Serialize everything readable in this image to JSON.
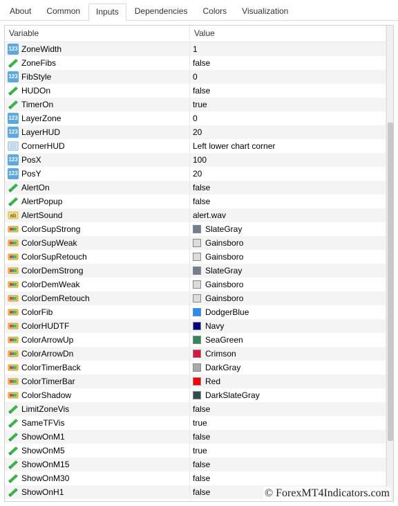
{
  "tabs": {
    "items": [
      "About",
      "Common",
      "Inputs",
      "Dependencies",
      "Colors",
      "Visualization"
    ],
    "active": 2
  },
  "headers": {
    "variable": "Variable",
    "value": "Value"
  },
  "rows": [
    {
      "icon": "int",
      "name": "ZoneWidth",
      "value": "1"
    },
    {
      "icon": "bool",
      "name": "ZoneFibs",
      "value": "false"
    },
    {
      "icon": "int",
      "name": "FibStyle",
      "value": "0"
    },
    {
      "icon": "bool",
      "name": "HUDOn",
      "value": "false"
    },
    {
      "icon": "bool",
      "name": "TimerOn",
      "value": "true"
    },
    {
      "icon": "int",
      "name": "LayerZone",
      "value": "0"
    },
    {
      "icon": "int",
      "name": "LayerHUD",
      "value": "20"
    },
    {
      "icon": "enum",
      "name": "CornerHUD",
      "value": "Left lower chart corner"
    },
    {
      "icon": "int",
      "name": "PosX",
      "value": "100"
    },
    {
      "icon": "int",
      "name": "PosY",
      "value": "20"
    },
    {
      "icon": "bool",
      "name": "AlertOn",
      "value": "false"
    },
    {
      "icon": "bool",
      "name": "AlertPopup",
      "value": "false"
    },
    {
      "icon": "str",
      "name": "AlertSound",
      "value": "alert.wav"
    },
    {
      "icon": "color",
      "name": "ColorSupStrong",
      "value": "SlateGray",
      "swatch": "#708090"
    },
    {
      "icon": "color",
      "name": "ColorSupWeak",
      "value": "Gainsboro",
      "swatch": "#dcdcdc"
    },
    {
      "icon": "color",
      "name": "ColorSupRetouch",
      "value": "Gainsboro",
      "swatch": "#dcdcdc"
    },
    {
      "icon": "color",
      "name": "ColorDemStrong",
      "value": "SlateGray",
      "swatch": "#708090"
    },
    {
      "icon": "color",
      "name": "ColorDemWeak",
      "value": "Gainsboro",
      "swatch": "#dcdcdc"
    },
    {
      "icon": "color",
      "name": "ColorDemRetouch",
      "value": "Gainsboro",
      "swatch": "#dcdcdc"
    },
    {
      "icon": "color",
      "name": "ColorFib",
      "value": "DodgerBlue",
      "swatch": "#1e90ff"
    },
    {
      "icon": "color",
      "name": "ColorHUDTF",
      "value": "Navy",
      "swatch": "#000080"
    },
    {
      "icon": "color",
      "name": "ColorArrowUp",
      "value": "SeaGreen",
      "swatch": "#2e8b57"
    },
    {
      "icon": "color",
      "name": "ColorArrowDn",
      "value": "Crimson",
      "swatch": "#dc143c"
    },
    {
      "icon": "color",
      "name": "ColorTimerBack",
      "value": "DarkGray",
      "swatch": "#a9a9a9"
    },
    {
      "icon": "color",
      "name": "ColorTimerBar",
      "value": "Red",
      "swatch": "#ff0000"
    },
    {
      "icon": "color",
      "name": "ColorShadow",
      "value": "DarkSlateGray",
      "swatch": "#2f4f4f"
    },
    {
      "icon": "bool",
      "name": "LimitZoneVis",
      "value": "false"
    },
    {
      "icon": "bool",
      "name": "SameTFVis",
      "value": "true"
    },
    {
      "icon": "bool",
      "name": "ShowOnM1",
      "value": "false"
    },
    {
      "icon": "bool",
      "name": "ShowOnM5",
      "value": "true"
    },
    {
      "icon": "bool",
      "name": "ShowOnM15",
      "value": "false"
    },
    {
      "icon": "bool",
      "name": "ShowOnM30",
      "value": "false"
    },
    {
      "icon": "bool",
      "name": "ShowOnH1",
      "value": "false"
    }
  ],
  "watermark": "© ForexMT4Indicators.com"
}
